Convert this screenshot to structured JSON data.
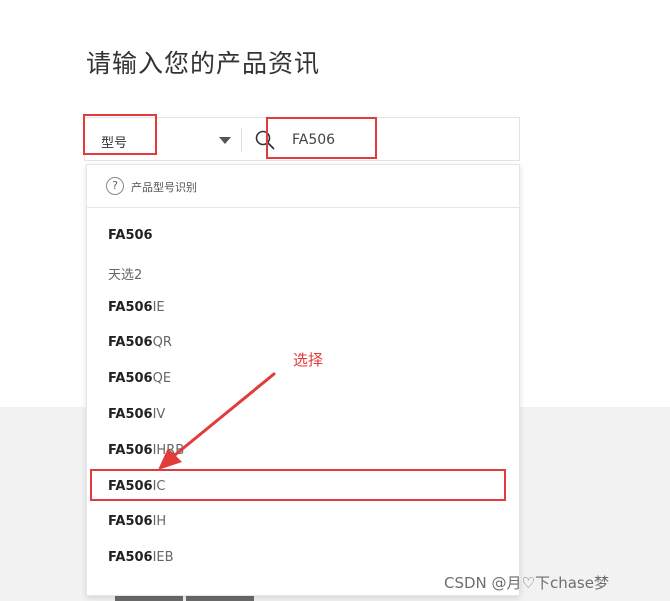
{
  "page": {
    "title": "请输入您的产品资讯"
  },
  "search": {
    "type_label": "型号",
    "query": "FA506"
  },
  "dropdown": {
    "help_text": "产品型号识别",
    "items": [
      {
        "bold": "FA506",
        "rest": ""
      },
      {
        "bold": "",
        "rest": "天选2"
      },
      {
        "bold": "FA506",
        "rest": "IE"
      },
      {
        "bold": "FA506",
        "rest": "QR"
      },
      {
        "bold": "FA506",
        "rest": "QE"
      },
      {
        "bold": "FA506",
        "rest": "IV"
      },
      {
        "bold": "FA506",
        "rest": "IHRB"
      },
      {
        "bold": "FA506",
        "rest": "IC"
      },
      {
        "bold": "FA506",
        "rest": "IH"
      },
      {
        "bold": "FA506",
        "rest": "IEB"
      }
    ]
  },
  "annotation": {
    "label": "选择",
    "color": "#e23b3b"
  },
  "watermark": "CSDN @月♡下chase梦",
  "icons": {
    "search": "search-icon",
    "help": "help-circle-icon",
    "caret": "caret-down-icon"
  }
}
